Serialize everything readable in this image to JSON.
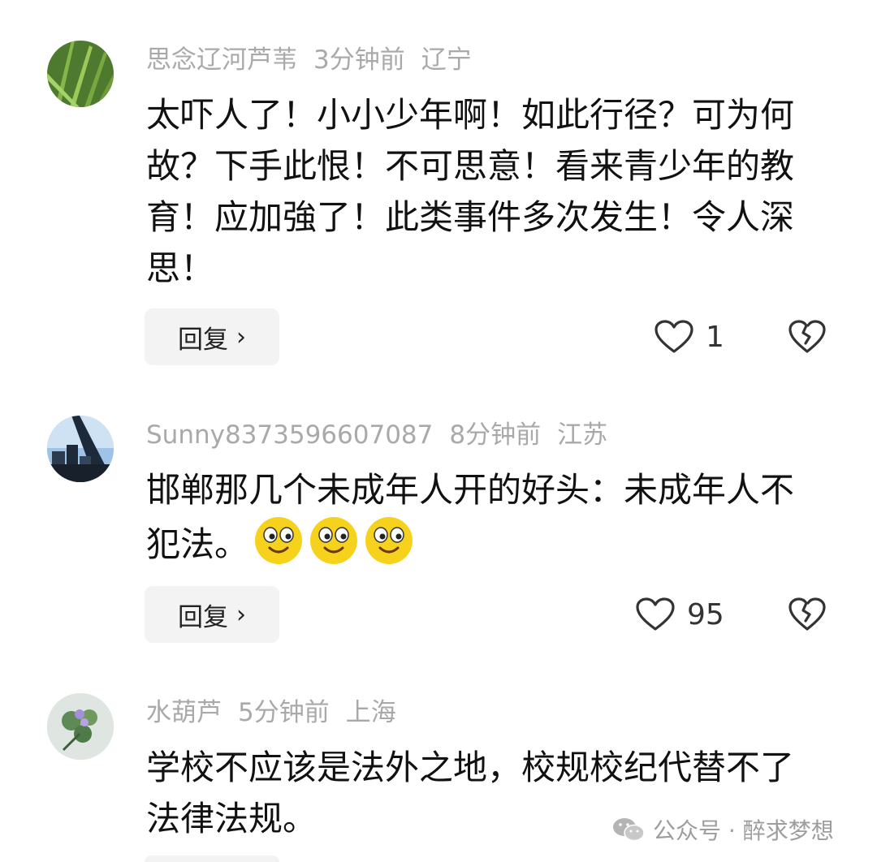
{
  "comments": [
    {
      "username": "思念辽河芦苇",
      "time": "3分钟前",
      "location": "辽宁",
      "text": "太吓人了！小小少年啊！如此行径？可为何故？下手此恨！不可思意！看来青少年的教育！应加強了！此类事件多次发生！令人深思！",
      "reply_label": "回复",
      "like_count": "1"
    },
    {
      "username": "Sunny8373596607087",
      "time": "8分钟前",
      "location": "江苏",
      "text": "邯郸那几个未成年人开的好头：未成年人不犯法。",
      "emoji_count": 3,
      "reply_label": "回复",
      "like_count": "95"
    },
    {
      "username": "水葫芦",
      "time": "5分钟前",
      "location": "上海",
      "text": "学校不应该是法外之地，校规校纪代替不了法律法规。"
    }
  ],
  "watermark": {
    "text": "公众号 · 醉求梦想",
    "icon": "wechat-icon"
  },
  "icons": {
    "like": "heart-outline-icon",
    "dislike": "broken-heart-icon",
    "reply_chevron": "chevron-right-icon"
  }
}
